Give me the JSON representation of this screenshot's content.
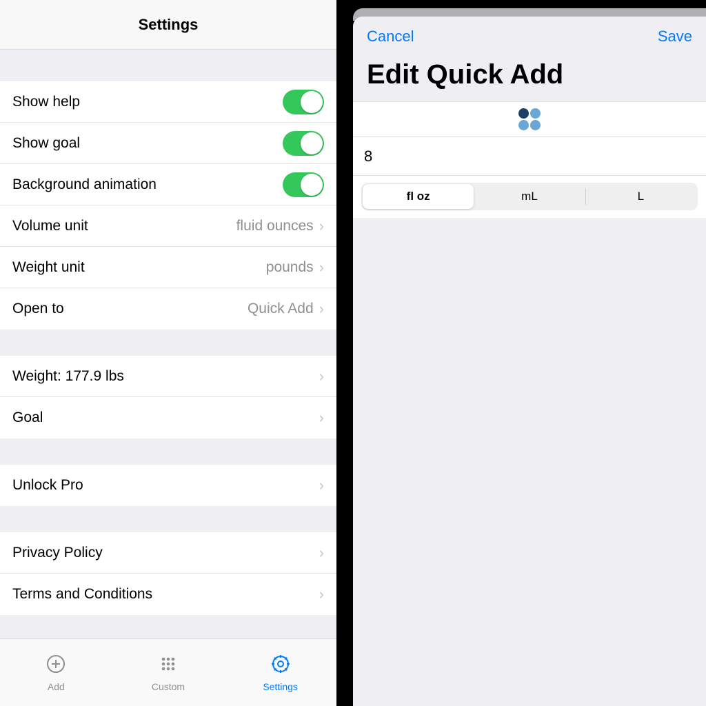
{
  "left": {
    "title": "Settings",
    "group1": {
      "show_help": "Show help",
      "show_goal": "Show goal",
      "bg_anim": "Background animation",
      "volume_unit_label": "Volume unit",
      "volume_unit_value": "fluid ounces",
      "weight_unit_label": "Weight unit",
      "weight_unit_value": "pounds",
      "open_to_label": "Open to",
      "open_to_value": "Quick Add"
    },
    "group2": {
      "weight": "Weight: 177.9 lbs",
      "goal": "Goal"
    },
    "group3": {
      "unlock_pro": "Unlock Pro"
    },
    "group4": {
      "privacy": "Privacy Policy",
      "terms": "Terms and Conditions"
    },
    "tabs": {
      "add": "Add",
      "custom": "Custom",
      "settings": "Settings"
    }
  },
  "right": {
    "cancel": "Cancel",
    "save": "Save",
    "title": "Edit Quick Add",
    "amount": "8",
    "units": {
      "floz": "fl oz",
      "ml": "mL",
      "l": "L"
    }
  }
}
